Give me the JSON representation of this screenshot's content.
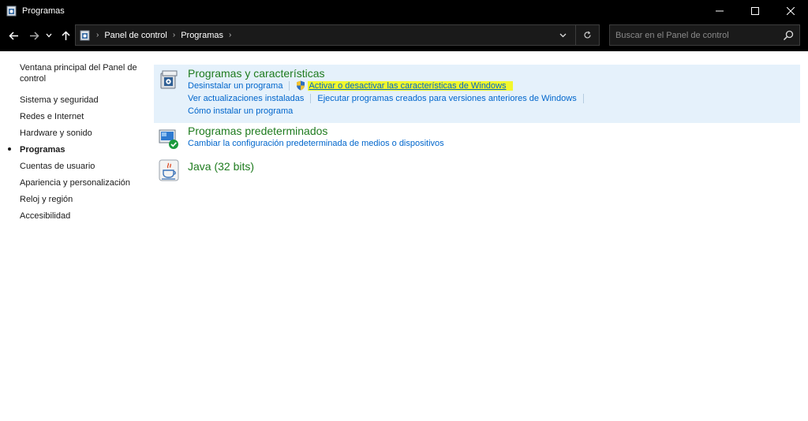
{
  "window": {
    "title": "Programas"
  },
  "address": {
    "breadcrumbs": [
      "Panel de control",
      "Programas"
    ]
  },
  "search": {
    "placeholder": "Buscar en el Panel de control"
  },
  "sidebar": {
    "items": [
      {
        "label": "Ventana principal del Panel de control",
        "current": false
      },
      {
        "label": "Sistema y seguridad",
        "current": false
      },
      {
        "label": "Redes e Internet",
        "current": false
      },
      {
        "label": "Hardware y sonido",
        "current": false
      },
      {
        "label": "Programas",
        "current": true
      },
      {
        "label": "Cuentas de usuario",
        "current": false
      },
      {
        "label": "Apariencia y personalización",
        "current": false
      },
      {
        "label": "Reloj y región",
        "current": false
      },
      {
        "label": "Accesibilidad",
        "current": false
      }
    ]
  },
  "categories": [
    {
      "title": "Programas y características",
      "icon": "programs-features-icon",
      "tasks": [
        "Desinstalar un programa",
        "Activar o desactivar las características de Windows",
        "Ver actualizaciones instaladas",
        "Ejecutar programas creados para versiones anteriores de Windows",
        "Cómo instalar un programa"
      ]
    },
    {
      "title": "Programas predeterminados",
      "icon": "default-programs-icon",
      "tasks": [
        "Cambiar la configuración predeterminada de medios o dispositivos"
      ]
    },
    {
      "title": "Java (32 bits)",
      "icon": "java-icon",
      "tasks": []
    }
  ],
  "colors": {
    "category_title": "#1e7b1e",
    "link": "#0066cc",
    "selected_bg": "#e5f1fb",
    "highlight": "#f2f72c"
  }
}
